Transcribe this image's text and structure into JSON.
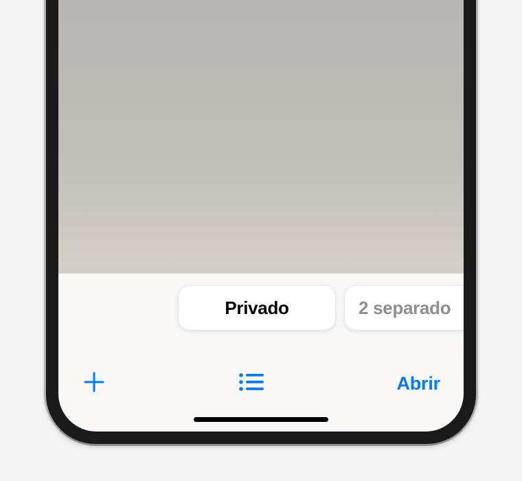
{
  "tabGroups": {
    "active": {
      "label": "Privado"
    },
    "next": {
      "label": "2 separado"
    }
  },
  "toolbar": {
    "openLabel": "Abrir"
  },
  "colors": {
    "accent": "#007aff"
  }
}
